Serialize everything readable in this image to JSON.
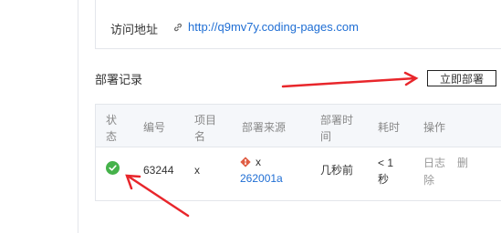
{
  "access": {
    "label": "访问地址",
    "url": "http://q9mv7y.coding-pages.com",
    "icon": "link-icon"
  },
  "records": {
    "title": "部署记录",
    "deploy_button": "立即部署"
  },
  "table": {
    "headers": {
      "status_1": "状",
      "status_2": "态",
      "number": "编号",
      "project_1": "项目",
      "project_2": "名",
      "source": "部署来源",
      "time_1": "部署时",
      "time_2": "间",
      "duration": "耗时",
      "actions": "操作"
    },
    "rows": [
      {
        "status": "success",
        "status_icon": "check-circle-icon",
        "number": "63244",
        "project": "x",
        "source_name": "x",
        "source_icon": "git-icon",
        "commit": "262001a",
        "time": "几秒前",
        "duration_1": "< 1",
        "duration_2": "秒",
        "log": "日志",
        "delete_1": "删",
        "delete_2": "除"
      }
    ]
  },
  "colors": {
    "link": "#1f6ed4",
    "success": "#45b24a",
    "git": "#e05d44",
    "arrow": "#e8262b"
  }
}
